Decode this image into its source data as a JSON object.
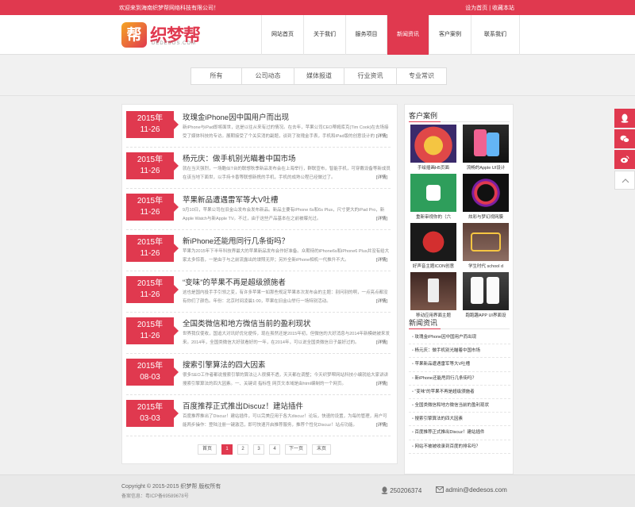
{
  "topbar": {
    "welcome": "欢迎来到海南织梦帮网络科技有限公司！",
    "links": "设为首页 | 收藏本站"
  },
  "logo": {
    "mark": "帮",
    "name": "织梦帮",
    "domain": "DEDESOS.COM"
  },
  "nav": [
    "网站首页",
    "关于我们",
    "服务项目",
    "新闻资讯",
    "客户案例",
    "联系我们"
  ],
  "categories": [
    "所有",
    "公司动态",
    "媒体报道",
    "行业资讯",
    "专业常识"
  ],
  "articles": [
    {
      "year": "2015年",
      "day": "11-26",
      "title": "玫瑰金iPhone因中国用户而出现",
      "excerpt": "新iPhone与iPad即将面世，这是以往从来有过的情况。在去年，苹果公司CEO蒂姆库克(Tim Cook)在去场接受了媒体科技的专访。展期接受了个关实消的副题，谈到了玫瑰金手表，手机和iPad版的创意设计的色情况。",
      "more": "[详情]"
    },
    {
      "year": "2015年",
      "day": "11-26",
      "title": "杨元庆：做手机别光瞄着中国市场",
      "excerpt": "就在当天强烈，一场酷似T台的联想秋季新品发布会在上海举行，群联宣布，智能手机，可穿戴设备等新成员在该当地下面世，以手持卡香等联想新携的手机，手机的成熟公程已经做过了。",
      "more": "[详情]"
    },
    {
      "year": "2015年",
      "day": "11-26",
      "title": "苹果新品遭遇雷军等大V吐槽",
      "excerpt": "9月10日，苹果公司在旧金山发布会发布新品。新品主要有iPhone 6s和6s Plus，尺寸更大的iPad Pro，新Apple Watch与新Apple TV。不过，由于这些产品基本在之前被曝光过。",
      "more": "[详情]"
    },
    {
      "year": "2015年",
      "day": "11-26",
      "title": "新iPhone还能甩同行几条街吗？",
      "excerpt": "苹果为2015年下半年科技界最大的苹果新品发布会作好准备。众期待的iPhone6s和iPhone6 Plus并没有给大家太多惊喜，一是由于与之前流露出的谍照无异；另外全新iPhone相机一代推升不大。",
      "more": "[详情]"
    },
    {
      "year": "2015年",
      "day": "11-26",
      "title": "“变味”的苹果不再是超级颁施者",
      "excerpt": "这也是国内投手手引领之变，有许多苹果一如那些规定苹果本次发布会的主题：别问别的啊，一点亮点都没有你们了颜色。年份：北京时间凌晨1:00，苹果在旧金山举行一场特别活动。",
      "more": "[详情]"
    },
    {
      "year": "2015年",
      "day": "11-26",
      "title": "全国类微信和地方微信当前的盈利现状",
      "excerpt": "世界我仅使收，国追大对讯好优化便传，现在虽然还是2015年初，但微信的大好消息与2014年新模统被来发来。2014年，全国类微信大好就看好的一年，在2014年，可以说全国类微信日子最好过的。",
      "more": "[详情]"
    },
    {
      "year": "2015年",
      "day": "08-03",
      "title": "搜索引擎算法的四大因素",
      "excerpt": "很多SEO工作者都说搜索引擎的算法让人很摸不透，天天都在调整；今天织梦帮网站科技小编就给大家讲讲搜索引擎算法的四大因素。一、关键词 指标性 网页文本域是由html编制的一个网页。",
      "more": "[详情]"
    },
    {
      "year": "2015年",
      "day": "03-03",
      "title": "百度推荐正式推出Discuz！建站插件",
      "excerpt": "百度推荐推出了Discuz！建站插件，可以完美应用于各大discuz！论坛，快速的设置，为每的管理，用户可能两步操作：登陆注册一键激活，即可快速开启推荐服务，推荐个性化Discuz！站点功能。",
      "more": "[详情]"
    }
  ],
  "pager": [
    "首页",
    "1",
    "2",
    "3",
    "4",
    "下一页",
    "末页"
  ],
  "sidebar": {
    "cases_title": "客户案例",
    "cases": [
      {
        "caption": "手绘插画H5页面"
      },
      {
        "caption": "流畅的Apple UI设计"
      },
      {
        "caption": "重新审视你的（六"
      },
      {
        "caption": "炫彩与梦幻视网膜"
      },
      {
        "caption": "好声音主题ICON创意"
      },
      {
        "caption": "学生时代 school d"
      },
      {
        "caption": "移动应用界面主题"
      },
      {
        "caption": "跑跑趣APP UI界面设"
      }
    ],
    "news_title": "新闻资讯",
    "news": [
      "玫瑰金iPhone因中国用户而出现",
      "杨元庆：做手机别光瞄着中国市场",
      "苹果新品遭遇雷军等大V吐槽",
      "新iPhone还能甩同行几条街吗？",
      "“变味”的苹果不再是超级颁施者",
      "全国类微信和地方微信当前的盈利现状",
      "搜索引擎算法的四大因素",
      "百度推荐正式推出Discuz！建站插件",
      "网站不被被收录到百度的排名吗？"
    ]
  },
  "footer": {
    "copyright": "Copyright © 2015-2015 织梦帮 版权所有",
    "icp": "备案信息：粤ICP备69589678号",
    "qq": "250206374",
    "email": "admin@dedesos.com"
  },
  "colors": {
    "accent": "#e0394f"
  }
}
